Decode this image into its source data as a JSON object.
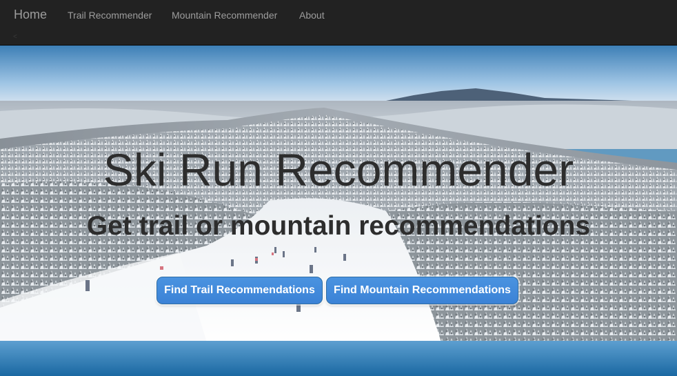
{
  "navbar": {
    "brand": "Home",
    "links": [
      "Trail Recommender",
      "Mountain Recommender",
      "About"
    ],
    "stray_mark": "<",
    "background_color": "#222222",
    "text_color": "#9d9d9d"
  },
  "hero": {
    "title": "Ski Run Recommender",
    "subtitle": "Get trail or mountain recommendations",
    "buttons": [
      "Find Trail Recommendations",
      "Find Mountain Recommendations"
    ],
    "button_color": "#428bca",
    "background_image": "snowy-mountain-ski-slope"
  }
}
